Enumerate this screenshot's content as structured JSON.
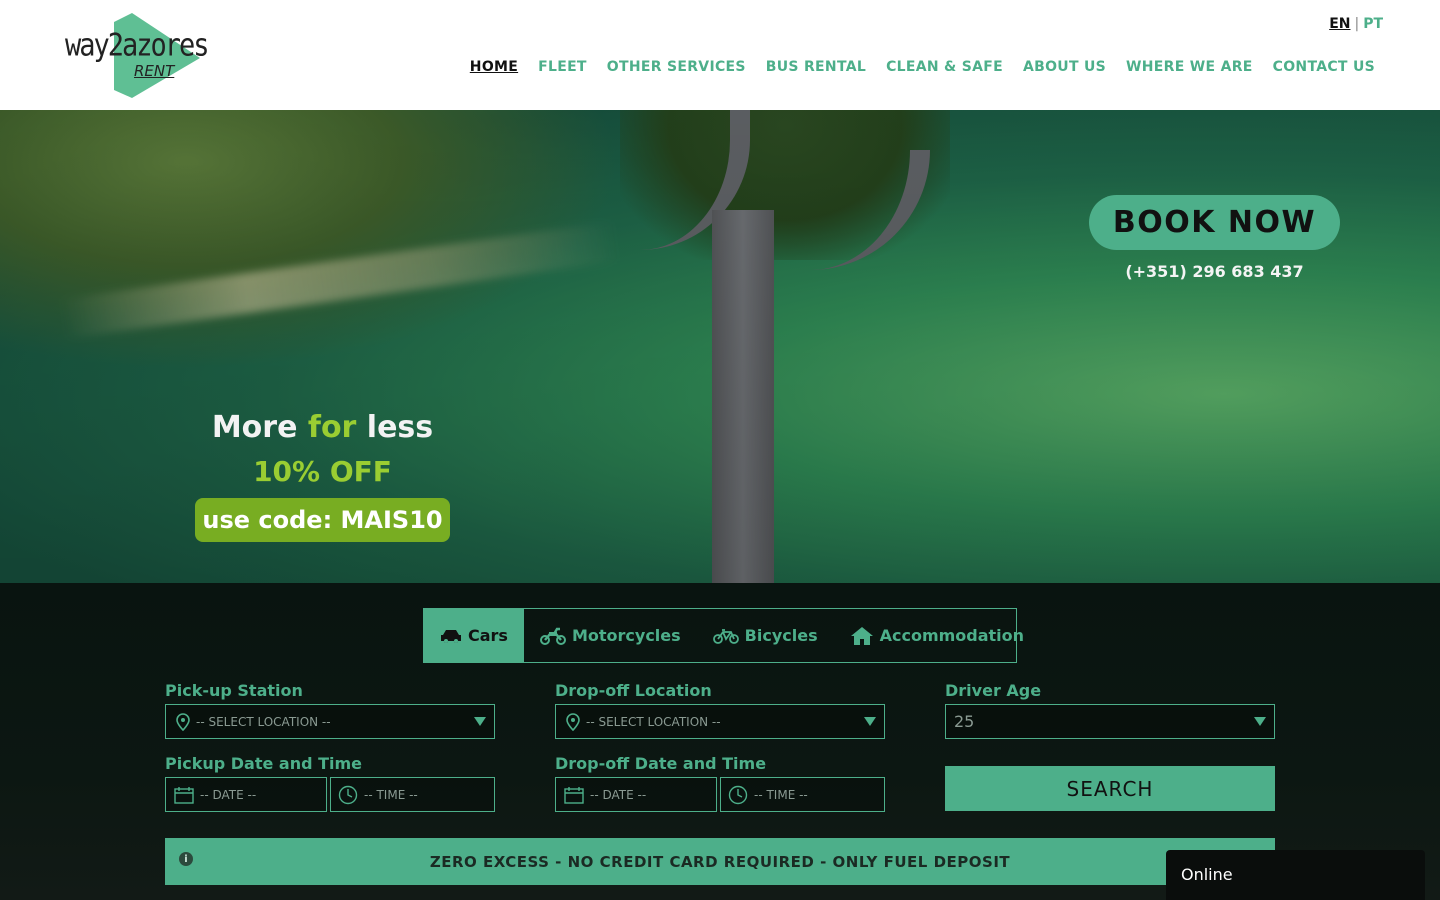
{
  "logo": {
    "main_text": "way2azores",
    "sub_text": "RENT"
  },
  "languages": {
    "active": "EN",
    "separator": "|",
    "other": "PT"
  },
  "nav": {
    "items": [
      {
        "label": "HOME"
      },
      {
        "label": "FLEET"
      },
      {
        "label": "OTHER SERVICES"
      },
      {
        "label": "BUS RENTAL"
      },
      {
        "label": "CLEAN & SAFE"
      },
      {
        "label": "ABOUT US"
      },
      {
        "label": "WHERE WE ARE"
      },
      {
        "label": "CONTACT US"
      }
    ],
    "active_index": 0
  },
  "hero": {
    "promo_more": "More ",
    "promo_for": "for",
    "promo_less": " less",
    "promo_discount": "10% OFF",
    "promo_code": "use code: MAIS10",
    "book_now": "BOOK NOW",
    "phone": "(+351) 296 683 437"
  },
  "booking": {
    "tabs": [
      {
        "label": "Cars",
        "icon": "car-icon"
      },
      {
        "label": "Motorcycles",
        "icon": "motorcycle-icon"
      },
      {
        "label": "Bicycles",
        "icon": "bicycle-icon"
      },
      {
        "label": "Accommodation",
        "icon": "house-icon"
      }
    ],
    "active_tab": 0,
    "pickup_station_label": "Pick-up Station",
    "pickup_station_placeholder": "-- SELECT LOCATION --",
    "dropoff_location_label": "Drop-off Location",
    "dropoff_location_placeholder": "-- SELECT LOCATION --",
    "driver_age_label": "Driver Age",
    "driver_age_value": "25",
    "pickup_datetime_label": "Pickup Date and Time",
    "dropoff_datetime_label": "Drop-off Date and Time",
    "date_placeholder": "-- DATE --",
    "time_placeholder": "-- TIME --",
    "search_label": "SEARCH",
    "info_icon": "i",
    "info_text": "ZERO EXCESS - NO CREDIT CARD REQUIRED - ONLY FUEL DEPOSIT"
  },
  "chat": {
    "status": "Online"
  },
  "colors": {
    "accent": "#4daf8a",
    "promo_green": "#78ad22",
    "dark_panel": "#0c1712"
  }
}
